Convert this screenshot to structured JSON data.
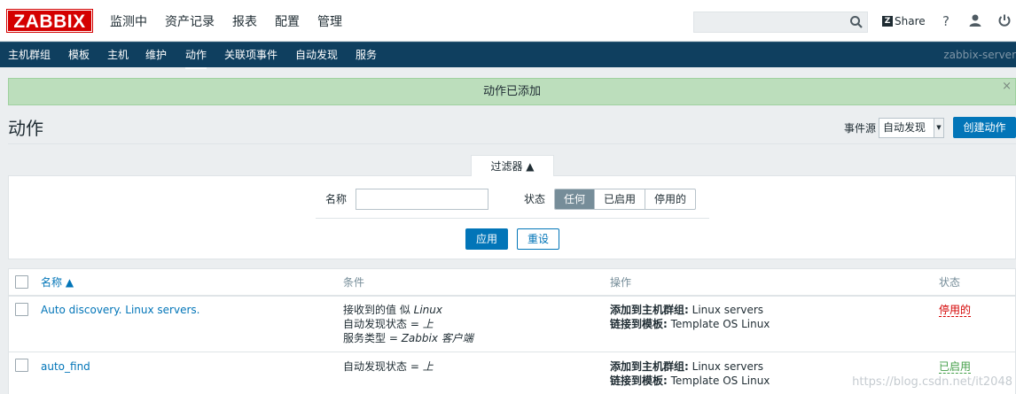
{
  "brand": {
    "logo_text": "ZABBIX",
    "color": "#d40000"
  },
  "main_menu": [
    "监测中",
    "资产记录",
    "报表",
    "配置",
    "管理"
  ],
  "header": {
    "search_placeholder": "",
    "share_label": "Share",
    "help_icon": "question-icon",
    "user_icon": "user-icon",
    "logout_icon": "power-icon"
  },
  "sub_menu": [
    "主机群组",
    "模板",
    "主机",
    "维护",
    "动作",
    "关联项事件",
    "自动发现",
    "服务"
  ],
  "server_name": "zabbix-server",
  "message": {
    "text": "动作已添加",
    "close": "×"
  },
  "page": {
    "title": "动作",
    "event_source_label": "事件源",
    "event_source_value": "自动发现",
    "create_button": "创建动作"
  },
  "filter": {
    "tab_label": "过滤器 ▲",
    "name_label": "名称",
    "name_value": "",
    "status_label": "状态",
    "status_options": [
      "任何",
      "已启用",
      "停用的"
    ],
    "status_selected": "任何",
    "apply": "应用",
    "reset": "重设"
  },
  "table": {
    "columns": {
      "name": "名称 ▲",
      "conditions": "条件",
      "operations": "操作",
      "status": "状态"
    },
    "rows": [
      {
        "name": "Auto discovery. Linux servers.",
        "cond1_text": "接收到的值 似 ",
        "cond1_value": "Linux",
        "cond2_text": "自动发现状态 = ",
        "cond2_value": "上",
        "cond3_text": "服务类型 = ",
        "cond3_value": "Zabbix 客户端",
        "op1_label": "添加到主机群组:",
        "op1_value": " Linux servers",
        "op2_label": "链接到模板:",
        "op2_value": " Template OS Linux",
        "status": "停用的"
      },
      {
        "name": "auto_find",
        "cond1_text": "自动发现状态 = ",
        "cond1_value": "上",
        "op1_label": "添加到主机群组:",
        "op1_value": " Linux servers",
        "op2_label": "链接到模板:",
        "op2_value": " Template OS Linux",
        "status": "已启用"
      }
    ]
  },
  "watermark": "https://blog.csdn.net/it2048"
}
